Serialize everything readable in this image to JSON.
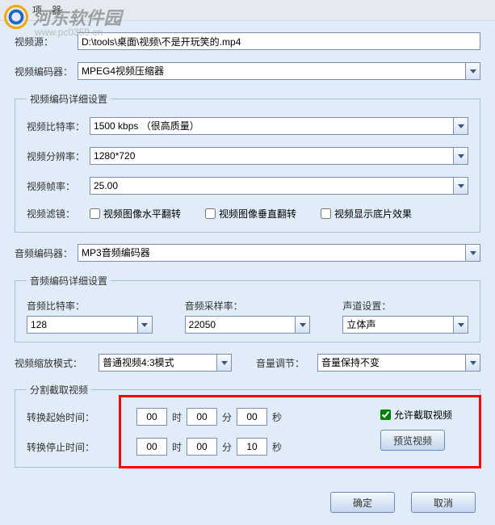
{
  "watermark": {
    "text": "河东软件园",
    "sub": "www.pc0359.cn"
  },
  "titlebar": "项…器",
  "rows": {
    "source_label": "视频源：",
    "source_value": "D:\\tools\\桌面\\视频\\不是开玩笑的.mp4",
    "vencoder_label": "视频编码器：",
    "vencoder_value": "MPEG4视频压缩器"
  },
  "vdetail": {
    "legend": "视频编码详细设置",
    "bitrate_label": "视频比特率：",
    "bitrate_value": "1500 kbps （很高质量）",
    "res_label": "视频分辨率：",
    "res_value": "1280*720",
    "fps_label": "视频帧率：",
    "fps_value": "25.00",
    "filter_label": "视频滤镜：",
    "cb1": "视频图像水平翻转",
    "cb2": "视频图像垂直翻转",
    "cb3": "视频显示底片效果"
  },
  "audio": {
    "encoder_label": "音频编码器：",
    "encoder_value": "MP3音频编码器"
  },
  "adetail": {
    "legend": "音频编码详细设置",
    "bitrate_label": "音频比特率：",
    "bitrate_value": "128",
    "sample_label": "音频采样率：",
    "sample_value": "22050",
    "channel_label": "声道设置：",
    "channel_value": "立体声"
  },
  "scale": {
    "mode_label": "视频缩放模式：",
    "mode_value": "普通视频4:3模式",
    "volume_label": "音量调节：",
    "volume_value": "音量保持不变"
  },
  "cut": {
    "legend": "分割截取视频",
    "start_label": "转换起始时间：",
    "stop_label": "转换停止时间：",
    "start": {
      "h": "00",
      "m": "00",
      "s": "00"
    },
    "stop": {
      "h": "00",
      "m": "00",
      "s": "10"
    },
    "unit_h": "时",
    "unit_m": "分",
    "unit_s": "秒",
    "allow_label": "允许截取视频",
    "preview_btn": "预览视频"
  },
  "footer": {
    "ok": "确定",
    "cancel": "取消"
  }
}
